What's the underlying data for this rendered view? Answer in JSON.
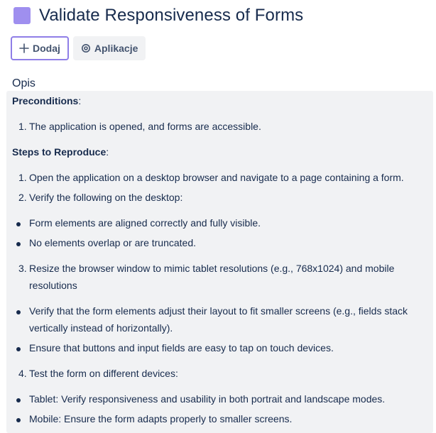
{
  "issue": {
    "title": "Validate Responsiveness of Forms",
    "type_color": "#9f8fef"
  },
  "actions": {
    "add_label": "Dodaj",
    "apps_label": "Aplikacje"
  },
  "description": {
    "label": "Opis",
    "preconditions_heading": "Preconditions",
    "preconditions_colon": ":",
    "pre_item_1_num": "1.",
    "pre_item_1": "The application is opened, and forms are accessible.",
    "steps_heading": "Steps to Reproduce",
    "steps_colon": ":",
    "step_1_num": "1.",
    "step_1": "Open the application on a desktop browser and navigate to a page containing a form.",
    "step_2_num": "2.",
    "step_2": "Verify the following on the desktop:",
    "step_2_bullet_1": "Form elements are aligned correctly and fully visible.",
    "step_2_bullet_2": "No elements overlap or are truncated.",
    "step_3_num": "3.",
    "step_3_line_1": "Resize the browser window to mimic tablet resolutions (e.g., 768x1024) and mobile",
    "step_3_line_2": "resolutions",
    "step_3_bullet_1_line_1": "Verify that the form elements adjust their layout to fit smaller screens (e.g., fields stack",
    "step_3_bullet_1_line_2": "vertically instead of horizontally).",
    "step_3_bullet_2": "Ensure that buttons and input fields are easy to tap on touch devices.",
    "step_4_num": "4.",
    "step_4": "Test the form on different devices:",
    "step_4_bullet_1": "Tablet: Verify responsiveness and usability in both portrait and landscape modes.",
    "step_4_bullet_2": "Mobile: Ensure the form adapts properly to smaller screens."
  }
}
